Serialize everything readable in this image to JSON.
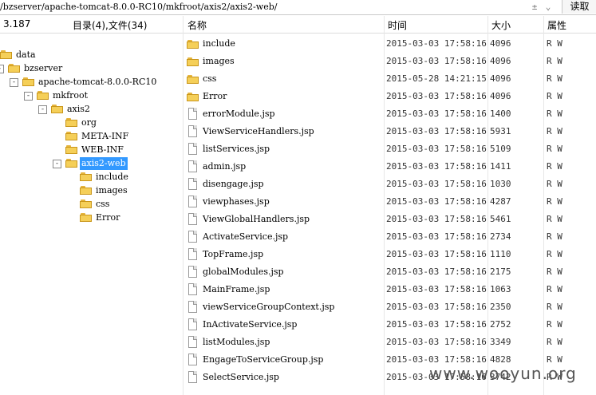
{
  "path": "/bzserver/apache-tomcat-8.0.0-RC10/mkfroot/axis2/axis2-web/",
  "read_button": "读取",
  "header": {
    "left_num": "3.187",
    "summary": "目录(4),文件(34)",
    "col_name": "名称",
    "col_time": "时间",
    "col_size": "大小",
    "col_attr": "属性"
  },
  "tree": [
    {
      "label": "data",
      "box": ""
    },
    {
      "label": "bzserver",
      "box": "-"
    },
    {
      "label": "apache-tomcat-8.0.0-RC10",
      "box": "-"
    },
    {
      "label": "mkfroot",
      "box": "-"
    },
    {
      "label": "axis2",
      "box": "-"
    },
    {
      "label": "org",
      "box": ""
    },
    {
      "label": "META-INF",
      "box": ""
    },
    {
      "label": "WEB-INF",
      "box": ""
    },
    {
      "label": "axis2-web",
      "box": "-",
      "selected": true
    },
    {
      "label": "include",
      "box": ""
    },
    {
      "label": "images",
      "box": ""
    },
    {
      "label": "css",
      "box": ""
    },
    {
      "label": "Error",
      "box": ""
    }
  ],
  "files": [
    {
      "name": "include",
      "type": "folder",
      "time": "2015-03-03 17:58:16",
      "size": "4096",
      "attr": "R W"
    },
    {
      "name": "images",
      "type": "folder",
      "time": "2015-03-03 17:58:16",
      "size": "4096",
      "attr": "R W"
    },
    {
      "name": "css",
      "type": "folder",
      "time": "2015-05-28 14:21:15",
      "size": "4096",
      "attr": "R W"
    },
    {
      "name": "Error",
      "type": "folder",
      "time": "2015-03-03 17:58:16",
      "size": "4096",
      "attr": "R W"
    },
    {
      "name": "errorModule.jsp",
      "type": "file",
      "time": "2015-03-03 17:58:16",
      "size": "1400",
      "attr": "R W"
    },
    {
      "name": "ViewServiceHandlers.jsp",
      "type": "file",
      "time": "2015-03-03 17:58:16",
      "size": "5931",
      "attr": "R W"
    },
    {
      "name": "listServices.jsp",
      "type": "file",
      "time": "2015-03-03 17:58:16",
      "size": "5109",
      "attr": "R W"
    },
    {
      "name": "admin.jsp",
      "type": "file",
      "time": "2015-03-03 17:58:16",
      "size": "1411",
      "attr": "R W"
    },
    {
      "name": "disengage.jsp",
      "type": "file",
      "time": "2015-03-03 17:58:16",
      "size": "1030",
      "attr": "R W"
    },
    {
      "name": "viewphases.jsp",
      "type": "file",
      "time": "2015-03-03 17:58:16",
      "size": "4287",
      "attr": "R W"
    },
    {
      "name": "ViewGlobalHandlers.jsp",
      "type": "file",
      "time": "2015-03-03 17:58:16",
      "size": "5461",
      "attr": "R W"
    },
    {
      "name": "ActivateService.jsp",
      "type": "file",
      "time": "2015-03-03 17:58:16",
      "size": "2734",
      "attr": "R W"
    },
    {
      "name": "TopFrame.jsp",
      "type": "file",
      "time": "2015-03-03 17:58:16",
      "size": "1110",
      "attr": "R W"
    },
    {
      "name": "globalModules.jsp",
      "type": "file",
      "time": "2015-03-03 17:58:16",
      "size": "2175",
      "attr": "R W"
    },
    {
      "name": "MainFrame.jsp",
      "type": "file",
      "time": "2015-03-03 17:58:16",
      "size": "1063",
      "attr": "R W"
    },
    {
      "name": "viewServiceGroupContext.jsp",
      "type": "file",
      "time": "2015-03-03 17:58:16",
      "size": "2350",
      "attr": "R W"
    },
    {
      "name": "InActivateService.jsp",
      "type": "file",
      "time": "2015-03-03 17:58:16",
      "size": "2752",
      "attr": "R W"
    },
    {
      "name": "listModules.jsp",
      "type": "file",
      "time": "2015-03-03 17:58:16",
      "size": "3349",
      "attr": "R W"
    },
    {
      "name": "EngageToServiceGroup.jsp",
      "type": "file",
      "time": "2015-03-03 17:58:16",
      "size": "4828",
      "attr": "R W"
    },
    {
      "name": "SelectService.jsp",
      "type": "file",
      "time": "2015-03-03 17:58:16",
      "size": "3742",
      "attr": "R W"
    }
  ],
  "watermark": "www.wooyun.org"
}
